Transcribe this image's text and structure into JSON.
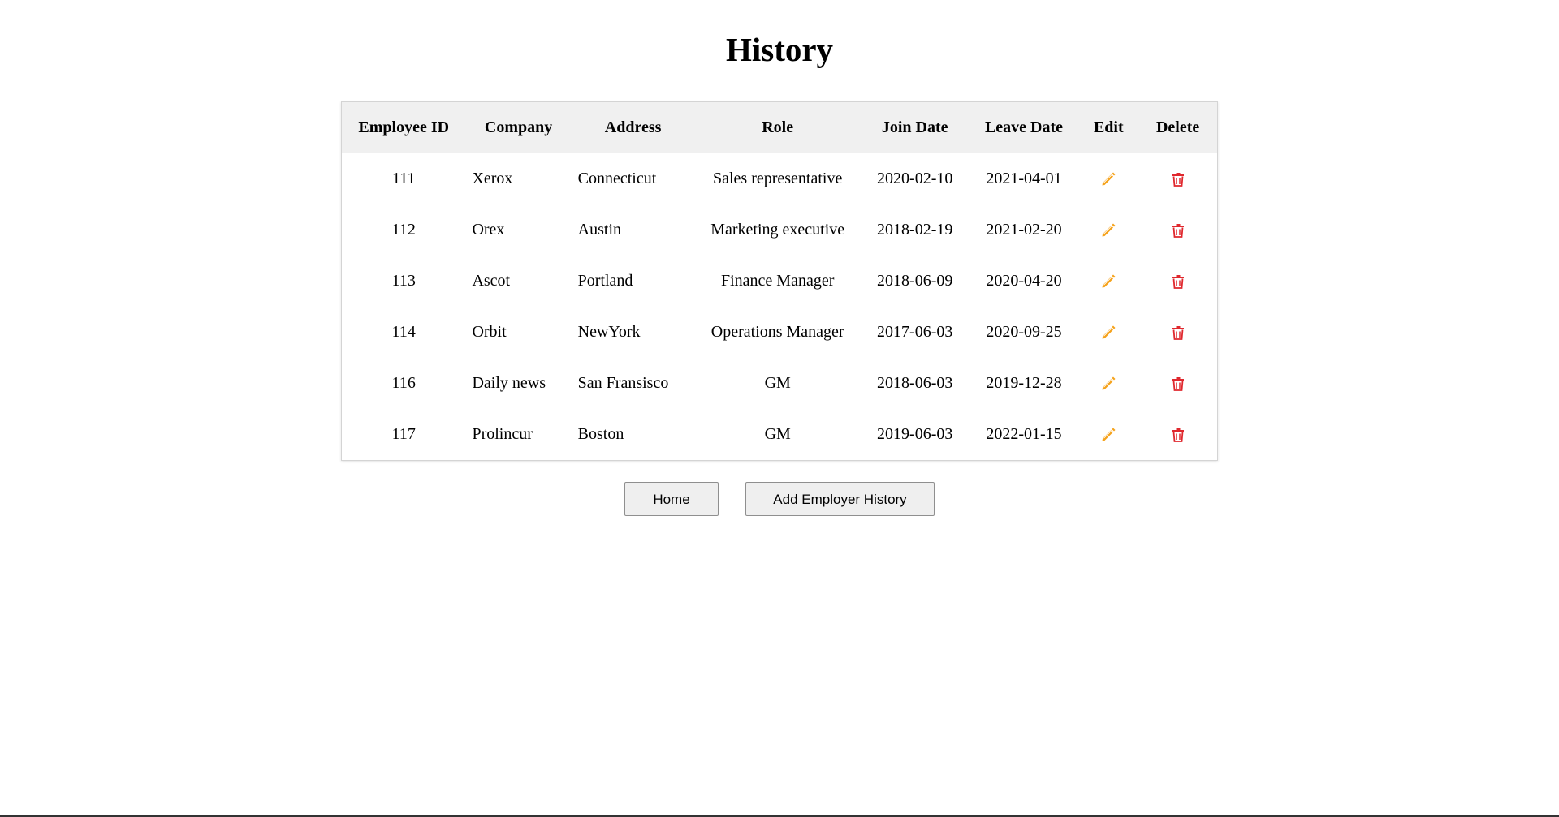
{
  "page": {
    "title": "History"
  },
  "table": {
    "headers": {
      "employee_id": "Employee ID",
      "company": "Company",
      "address": "Address",
      "role": "Role",
      "join_date": "Join Date",
      "leave_date": "Leave Date",
      "edit": "Edit",
      "delete": "Delete"
    },
    "rows": [
      {
        "employee_id": "111",
        "company": "Xerox",
        "address": "Connecticut",
        "role": "Sales representative",
        "join_date": "2020-02-10",
        "leave_date": "2021-04-01"
      },
      {
        "employee_id": "112",
        "company": "Orex",
        "address": "Austin",
        "role": "Marketing executive",
        "join_date": "2018-02-19",
        "leave_date": "2021-02-20"
      },
      {
        "employee_id": "113",
        "company": "Ascot",
        "address": "Portland",
        "role": "Finance Manager",
        "join_date": "2018-06-09",
        "leave_date": "2020-04-20"
      },
      {
        "employee_id": "114",
        "company": "Orbit",
        "address": "NewYork",
        "role": "Operations Manager",
        "join_date": "2017-06-03",
        "leave_date": "2020-09-25"
      },
      {
        "employee_id": "116",
        "company": "Daily news",
        "address": "San Fransisco",
        "role": "GM",
        "join_date": "2018-06-03",
        "leave_date": "2019-12-28"
      },
      {
        "employee_id": "117",
        "company": "Prolincur",
        "address": "Boston",
        "role": "GM",
        "join_date": "2019-06-03",
        "leave_date": "2022-01-15"
      }
    ],
    "icons": {
      "edit": "pencil-icon",
      "delete": "trash-icon"
    }
  },
  "actions": {
    "home_label": "Home",
    "add_label": "Add Employer History"
  },
  "colors": {
    "edit_icon": "#f5a21b",
    "delete_icon": "#e0282e",
    "header_bg": "#f0f0f0"
  }
}
